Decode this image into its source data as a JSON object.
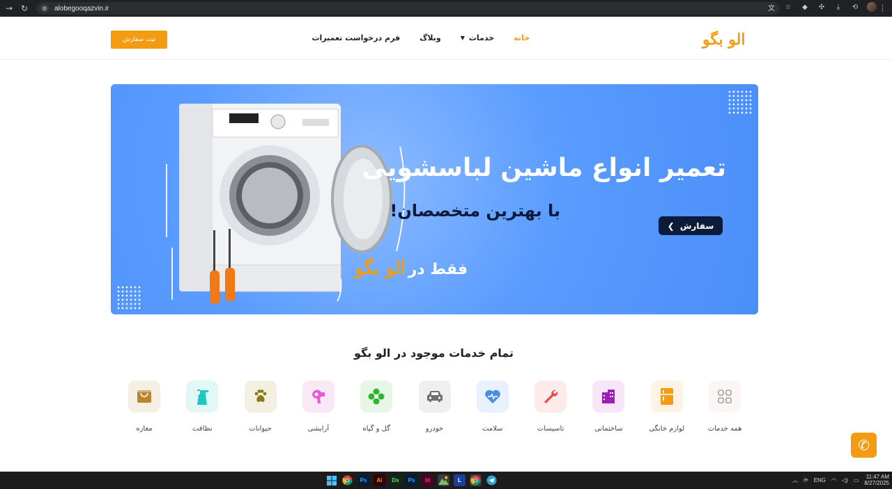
{
  "browser": {
    "url": "alobegooqazvin.ir"
  },
  "header": {
    "logo": "الو بگو",
    "order_button": "ثبت سفارش",
    "nav": [
      {
        "label": "خانه",
        "active": true
      },
      {
        "label": "خدمات",
        "dropdown": true
      },
      {
        "label": "وبلاگ"
      },
      {
        "label": "فرم درخواست تعمیرات"
      }
    ]
  },
  "banner": {
    "title": "تعمیر انواع ماشین لباسشویی",
    "subtitle": "با بهترین متخصصان!",
    "button": "سفارش",
    "tagline_prefix": "فقط در",
    "tagline_brand": "الو بگو"
  },
  "services": {
    "title": "تمام خدمات موجود در الو بگو",
    "items": [
      {
        "label": "همه خدمات",
        "icon": "grid-icon",
        "color": "#a0a0a0",
        "bg": "#fbf6f4"
      },
      {
        "label": "لوازم خانگی",
        "icon": "fridge-icon",
        "color": "#f39c12",
        "bg": "#fdf3e4"
      },
      {
        "label": "ساختمانی",
        "icon": "building-icon",
        "color": "#9b1fb8",
        "bg": "#f6e6f8"
      },
      {
        "label": "تاسیسات",
        "icon": "wrench-icon",
        "color": "#e84a4a",
        "bg": "#fdebeb"
      },
      {
        "label": "سلامت",
        "icon": "heart-icon",
        "color": "#4a90e2",
        "bg": "#e8f1fc"
      },
      {
        "label": "خودرو",
        "icon": "car-icon",
        "color": "#707070",
        "bg": "#efefef"
      },
      {
        "label": "گل و گیاه",
        "icon": "flower-icon",
        "color": "#2db52d",
        "bg": "#e6f7e6"
      },
      {
        "label": "آرایشی",
        "icon": "hairdryer-icon",
        "color": "#e85ad0",
        "bg": "#fbe8f7"
      },
      {
        "label": "حیوانات",
        "icon": "paw-icon",
        "color": "#8b7a1a",
        "bg": "#f3f0e2"
      },
      {
        "label": "نظافت",
        "icon": "spray-icon",
        "color": "#1fc7c0",
        "bg": "#e2f8f7"
      },
      {
        "label": "مغازه",
        "icon": "shop-icon",
        "color": "#b8862f",
        "bg": "#f6efe4"
      }
    ]
  },
  "taskbar": {
    "language": "ENG",
    "time": "11:47 AM",
    "date": "8/27/2025",
    "apps": [
      {
        "name": "windows-start-icon",
        "text": "",
        "bg": "#1c1c1c"
      },
      {
        "name": "chrome-icon",
        "text": "",
        "bg": "#1c1c1c"
      },
      {
        "name": "photoshop-icon",
        "text": "Ps",
        "bg": "#001e36",
        "color": "#31a8ff"
      },
      {
        "name": "illustrator-icon",
        "text": "Ai",
        "bg": "#330000",
        "color": "#ff9a00"
      },
      {
        "name": "dimension-icon",
        "text": "Ds",
        "bg": "#0e2a14",
        "color": "#6fd96f"
      },
      {
        "name": "photoshop-2-icon",
        "text": "Ps",
        "bg": "#001e36",
        "color": "#31a8ff"
      },
      {
        "name": "indesign-icon",
        "text": "Id",
        "bg": "#49021f",
        "color": "#ff3366"
      },
      {
        "name": "app-mountain-icon",
        "text": "",
        "bg": "#3b3b3b"
      },
      {
        "name": "app-l-icon",
        "text": "L",
        "bg": "#1a3f9e",
        "color": "#ffffff"
      },
      {
        "name": "chrome-2-icon",
        "text": "",
        "bg": "#3a3a3a"
      },
      {
        "name": "telegram-icon",
        "text": "",
        "bg": "#1c1c1c"
      }
    ]
  }
}
